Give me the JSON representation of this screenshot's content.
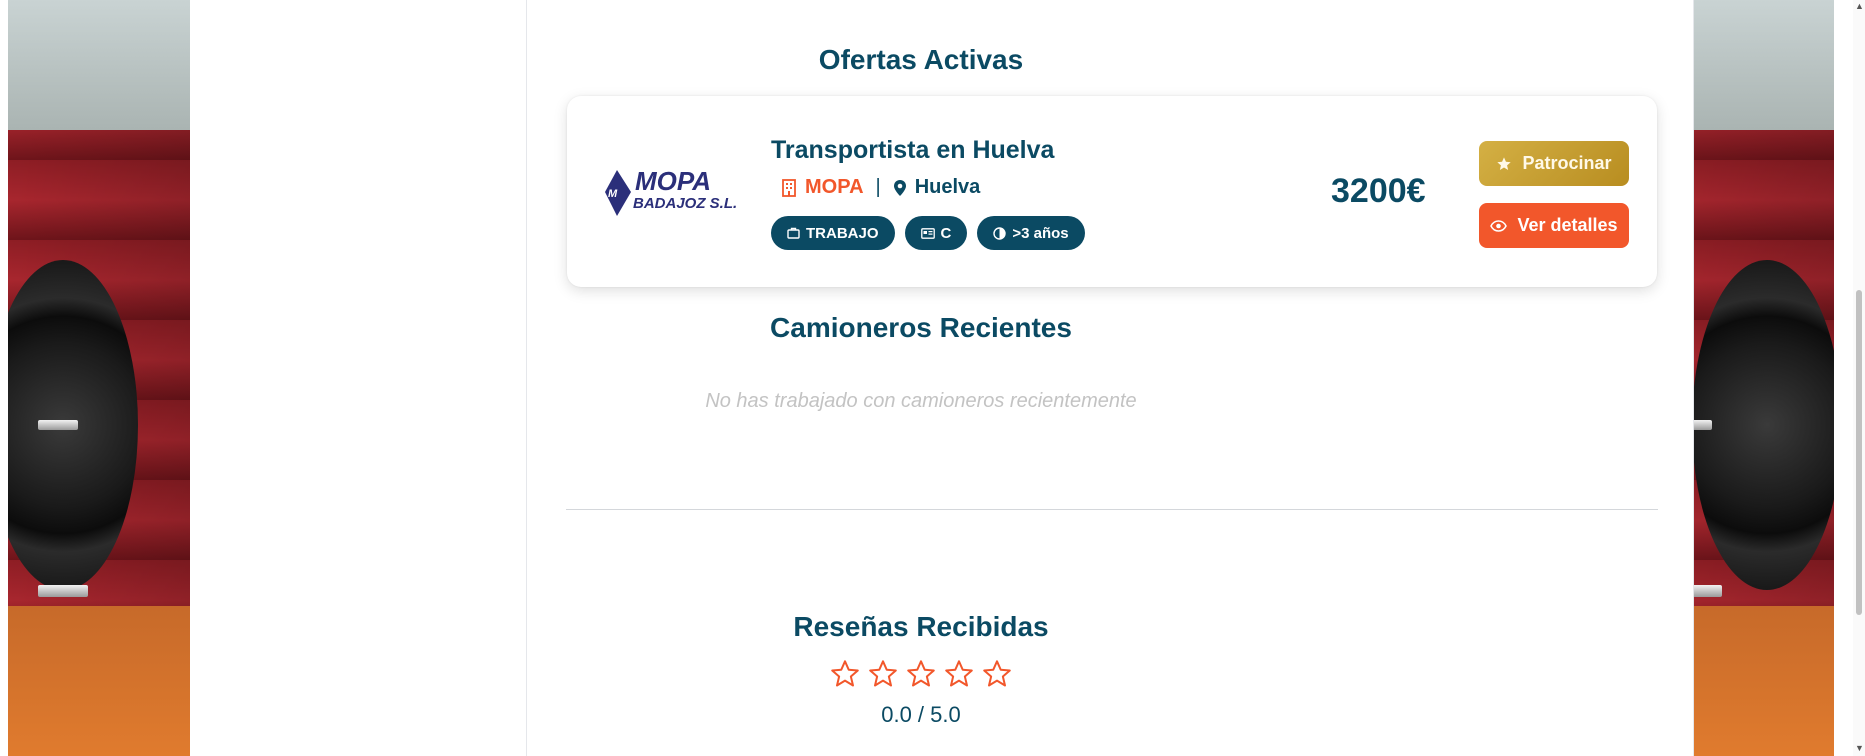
{
  "sections": {
    "offers_title": "Ofertas Activas",
    "truckers_title": "Camioneros Recientes",
    "reviews_title": "Reseñas Recibidas"
  },
  "offer": {
    "logo_text_main": "MOPA",
    "logo_text_sub": "BADAJOZ S.L.",
    "title": "Transportista en Huelva",
    "company": "MOPA",
    "separator": "|",
    "location": "Huelva",
    "tags": [
      {
        "icon": "briefcase-icon",
        "label": "TRABAJO"
      },
      {
        "icon": "license-card-icon",
        "label": "C"
      },
      {
        "icon": "experience-icon",
        "label": ">3 años"
      }
    ],
    "price": "3200€",
    "sponsor_label": "Patrocinar",
    "details_label": "Ver detalles"
  },
  "truckers": {
    "empty_message": "No has trabajado con camioneros recientemente"
  },
  "reviews": {
    "stars_filled": 0,
    "stars_total": 5,
    "rating_text": "0.0 / 5.0"
  },
  "colors": {
    "primary": "#0b4a63",
    "accent": "#f2572b",
    "gold": "#c9a338"
  }
}
